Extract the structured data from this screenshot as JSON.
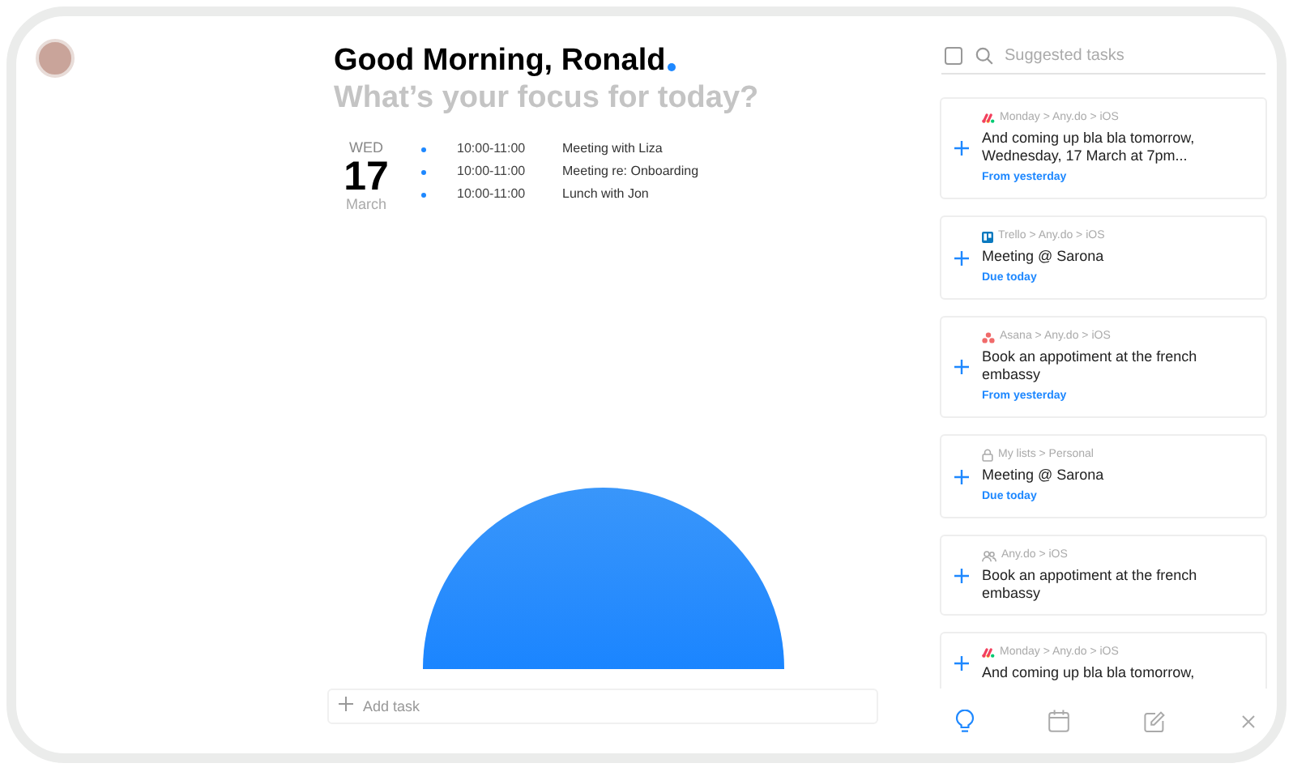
{
  "greeting": {
    "title": "Good Morning, Ronald",
    "subtitle": "What’s your focus for today?"
  },
  "date": {
    "weekday": "WED",
    "day": "17",
    "month": "March"
  },
  "events": [
    {
      "time": "10:00-11:00",
      "title": "Meeting with Liza"
    },
    {
      "time": "10:00-11:00",
      "title": "Meeting re: Onboarding"
    },
    {
      "time": "10:00-11:00",
      "title": "Lunch with Jon"
    }
  ],
  "add_task": {
    "placeholder": "Add task"
  },
  "suggested": {
    "checked": false,
    "placeholder": "Suggested tasks"
  },
  "cards": [
    {
      "kind": "monday",
      "source": "Monday > Any.do > iOS",
      "title": "And coming up bla bla tomorrow, Wednesday, 17 March at 7pm...",
      "due": "From yesterday"
    },
    {
      "kind": "trello",
      "source": "Trello > Any.do > iOS",
      "title": "Meeting @ Sarona",
      "due": "Due today"
    },
    {
      "kind": "asana",
      "source": "Asana > Any.do > iOS",
      "title": "Book an appotiment at the french embassy",
      "due": "From yesterday"
    },
    {
      "kind": "lock",
      "source": "My lists > Personal",
      "title": "Meeting @ Sarona",
      "due": "Due today"
    },
    {
      "kind": "people",
      "source": "Any.do > iOS",
      "title": "Book an appotiment at the french embassy"
    },
    {
      "kind": "monday",
      "source": "Monday > Any.do > iOS",
      "title": "And coming up bla bla tomorrow,"
    }
  ],
  "toolbar": [
    {
      "kind": "bulb",
      "selected": true
    },
    {
      "kind": "calendar",
      "selected": false
    },
    {
      "kind": "edit",
      "selected": false
    },
    {
      "kind": "close",
      "selected": false
    }
  ]
}
